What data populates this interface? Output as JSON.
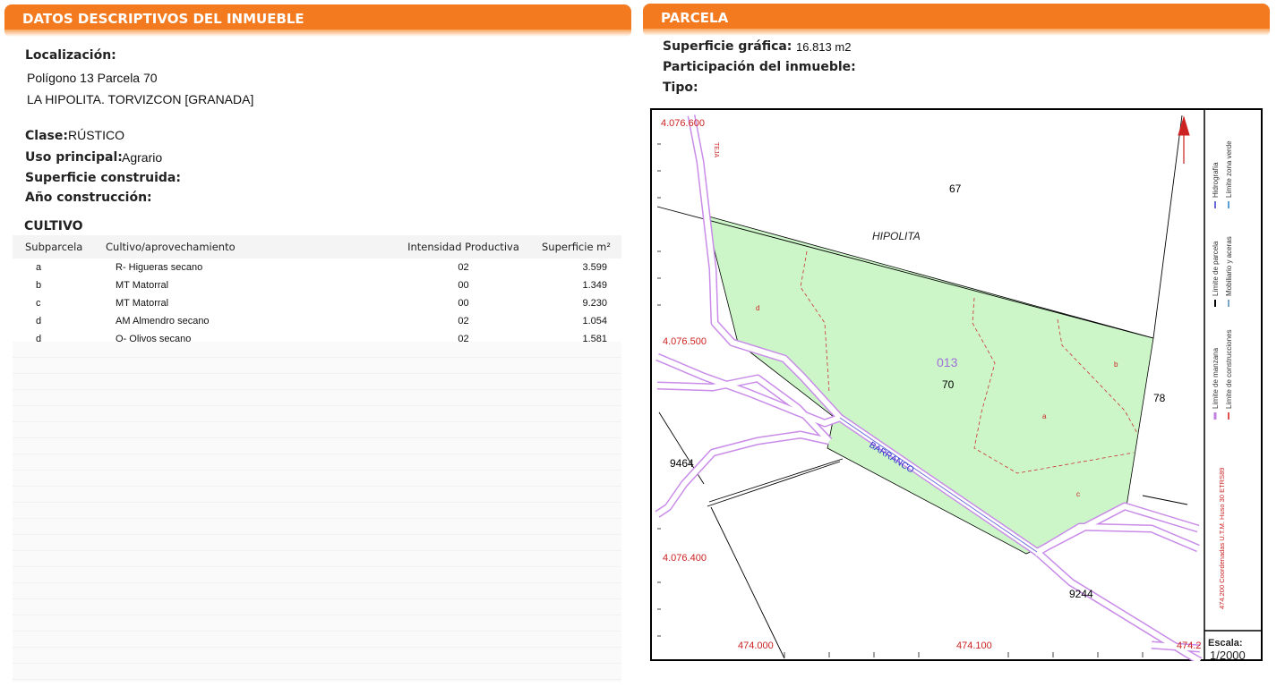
{
  "left_panel": {
    "header": "DATOS DESCRIPTIVOS DEL INMUEBLE",
    "localizacion_label": "Localización:",
    "localizacion_line1": "Polígono 13 Parcela 70",
    "localizacion_line2": "LA HIPOLITA. TORVIZCON [GRANADA]",
    "clase_label": "Clase:",
    "clase_value": "RÚSTICO",
    "uso_label": "Uso principal:",
    "uso_value": "Agrario",
    "superficie_label": "Superficie construida:",
    "anio_label": "Año construcción:",
    "cultivo_title": "CULTIVO",
    "columns": [
      "Subparcela",
      "Cultivo/aprovechamiento",
      "Intensidad Productiva",
      "Superficie m²"
    ],
    "rows": [
      {
        "sub": "a",
        "cultivo": "R- Higueras secano",
        "intensidad": "02",
        "superficie": "3.599"
      },
      {
        "sub": "b",
        "cultivo": "MT Matorral",
        "intensidad": "00",
        "superficie": "1.349"
      },
      {
        "sub": "c",
        "cultivo": "MT Matorral",
        "intensidad": "00",
        "superficie": "9.230"
      },
      {
        "sub": "d",
        "cultivo": "AM Almendro secano",
        "intensidad": "02",
        "superficie": "1.054"
      },
      {
        "sub": "d",
        "cultivo": "O- Olivos secano",
        "intensidad": "02",
        "superficie": "1.581"
      }
    ]
  },
  "right_panel": {
    "header": "PARCELA",
    "superficie_grafica_label": "Superficie gráfica:",
    "superficie_grafica_value": "16.813 m2",
    "participacion_label": "Participación del inmueble:",
    "tipo_label": "Tipo:"
  },
  "map": {
    "coord_labels": [
      "4.076.600",
      "4.076.500",
      "4.076.400",
      "474.000",
      "474.100",
      "474.2"
    ],
    "parcel_numbers": [
      "67",
      "78",
      "9464",
      "9244",
      "70"
    ],
    "polygon_number": "013",
    "place_labels": [
      "HIPOLITA",
      "BARRANCO",
      "TEJA"
    ],
    "subparcel_labels": [
      "d",
      "b",
      "a",
      "c"
    ],
    "legend": [
      {
        "text": "Hidrografía",
        "color": "#6a6ad8"
      },
      {
        "text": "Límite zona verde",
        "color": "#5aa0d8"
      },
      {
        "text": "Límite de parcela",
        "color": "#000000"
      },
      {
        "text": "Mobiliario y aceras",
        "color": "#7aa6c8"
      },
      {
        "text": "Límite de manzana",
        "color": "#c080e0"
      },
      {
        "text": "Límite de construcciones",
        "color": "#e05050"
      },
      {
        "text": "474.200 Coordenadas U.T.M. Huso 30 ETRS89",
        "color": "#cc2222"
      }
    ],
    "scale_label": "Escala:",
    "scale_value": "1/2000",
    "colors": {
      "parcel_fill": "#ccf5c8",
      "road": "#c98ce8",
      "coord": "#cc2222"
    }
  }
}
